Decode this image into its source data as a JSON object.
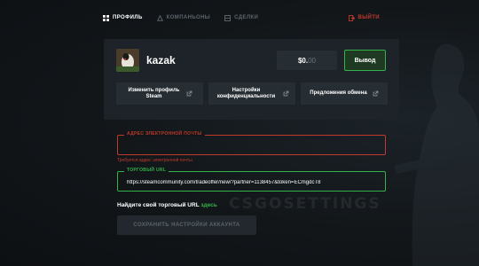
{
  "nav": {
    "items": [
      {
        "label": "ПРОФИЛЬ",
        "icon": "profile-icon",
        "active": true
      },
      {
        "label": "КОМПАНЬОНЫ",
        "icon": "companions-icon",
        "active": false
      },
      {
        "label": "СДЕЛКИ",
        "icon": "deals-icon",
        "active": false
      }
    ],
    "logout_label": "ВЫЙТИ"
  },
  "profile": {
    "username": "kazak",
    "balance_main": "$0.",
    "balance_cents": "00",
    "withdraw_label": "Вывод",
    "links": [
      {
        "label": "Изменить профиль Steam",
        "icon": "external-link-icon"
      },
      {
        "label": "Настройки конфиденциальности",
        "icon": "external-link-icon"
      },
      {
        "label": "Предложения обмена",
        "icon": "external-link-icon"
      }
    ]
  },
  "email": {
    "label": "АДРЕС ЭЛЕКТРОННОЙ ПОЧТЫ",
    "value": "",
    "error": "Требуется адрес электронной почты"
  },
  "trade": {
    "label": "ТОРГОВЫЙ URL",
    "value": "https://steamcommunity.com/tradeoffer/new/?partner=1138457&token=ECmgdcT8",
    "find_prefix": "Найдите свой торговый URL",
    "find_link": "здесь"
  },
  "save_label": "СОХРАНИТЬ НАСТРОЙКИ АККАУНТА",
  "watermark": "CSGOSETTINGS",
  "colors": {
    "accent_green": "#33b249",
    "error_red": "#c0392b",
    "panel": "#1d2328",
    "background": "#121619"
  }
}
